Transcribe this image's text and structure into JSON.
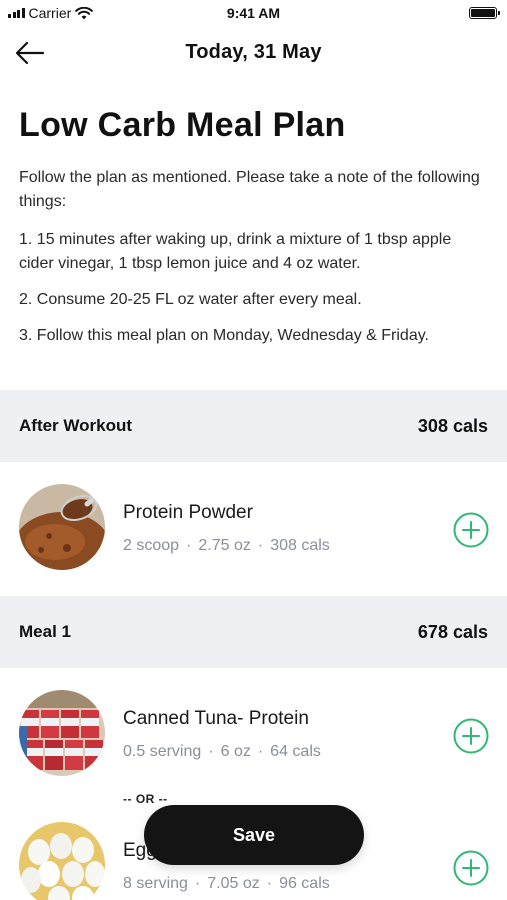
{
  "status_bar": {
    "carrier": "Carrier",
    "time": "9:41 AM",
    "icons": [
      "signal-icon",
      "wifi-icon",
      "battery-icon"
    ]
  },
  "nav": {
    "back_icon": "arrow-left-icon",
    "title": "Today, 31 May"
  },
  "plan": {
    "title": "Low Carb Meal Plan",
    "intro": "Follow the plan as mentioned. Please take a note of the following things:",
    "notes": [
      "1. 15 minutes after waking up, drink a mixture of 1 tbsp apple cider vinegar, 1 tbsp lemon juice and 4 oz water.",
      "2. Consume 20-25 FL oz water after every meal.",
      "3. Follow this meal plan on Monday, Wednesday & Friday."
    ]
  },
  "sections": [
    {
      "name": "After Workout",
      "cals": "308 cals",
      "foods": [
        {
          "name": "Protein Powder",
          "quantity": "2 scoop",
          "weight": "2.75 oz",
          "cals": "308 cals",
          "image": "protein-powder-photo"
        }
      ]
    },
    {
      "name": "Meal 1",
      "cals": "678 cals",
      "foods": [
        {
          "name": "Canned Tuna- Protein",
          "quantity": "0.5 serving",
          "weight": "6 oz",
          "cals": "64 cals",
          "image": "canned-tuna-photo"
        },
        {
          "name": "Eggs",
          "quantity": "8 serving",
          "weight": "7.05 oz",
          "cals": "96 cals",
          "image": "eggs-photo"
        }
      ]
    }
  ],
  "separator": "-- OR --",
  "meta_dot": "·",
  "actions": {
    "add_icon": "plus-circle-icon",
    "save_label": "Save"
  },
  "colors": {
    "accent_green": "#2eb872",
    "section_bg": "#eef0f3",
    "save_button_bg": "#141414",
    "meta_text": "#8a8f98"
  }
}
